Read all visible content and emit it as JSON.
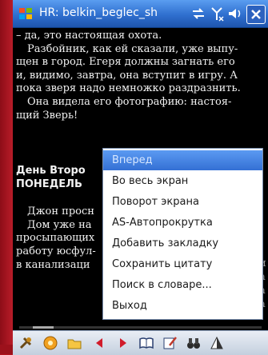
{
  "window": {
    "title": "HR: belkin_beglec_sh",
    "icons": [
      "start-flag-icon",
      "connectivity-icon",
      "antenna-icon",
      "speaker-icon",
      "close-icon"
    ]
  },
  "book": {
    "lines": [
      "– да, это настоящая охота.",
      "Разбойник, как ей сказали, уже выпу-",
      "щен в город. Егеря должны загнать его",
      "и, видимо, завтра, она вступит в игру. А",
      "пока зверя надо немножко раздразнить.",
      "Она видела его фотографию: настоя-",
      "щий Зверь!",
      "День Второ",
      "ПОНЕДЕЛЬ",
      "Джон просн",
      "Дом уже на",
      "просыпающих",
      "работу юсфул-",
      "в канализаци"
    ],
    "right_fragments": [
      "и",
      "а",
      "а",
      "а"
    ]
  },
  "context_menu": {
    "items": [
      "Вперед",
      "Во весь экран",
      "Поворот экрана",
      "AS-Автопрокрутка",
      "Добавить закладку",
      "Сохранить цитату",
      "Поиск в словаре...",
      "Выход"
    ],
    "selected_index": 0
  },
  "scroll": {
    "position_fraction": 0.06
  },
  "toolbar": {
    "icons": [
      "tools-icon",
      "disc-icon",
      "folder-icon",
      "back-arrow-icon",
      "forward-arrow-icon",
      "book-icon",
      "edit-icon",
      "binoculars-icon",
      "contrast-icon"
    ]
  }
}
